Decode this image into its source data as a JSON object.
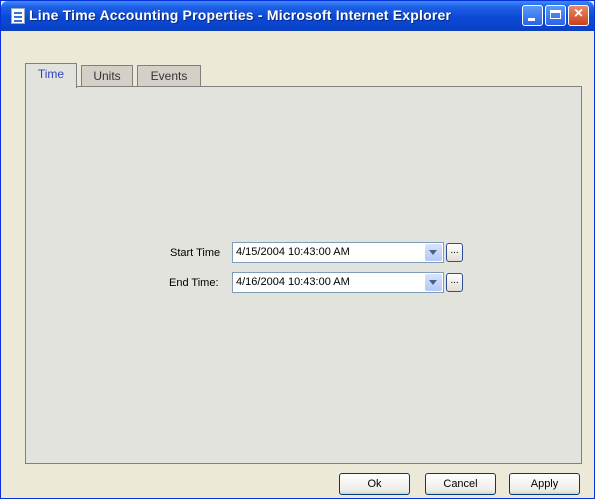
{
  "window": {
    "title": "Line Time Accounting Properties - Microsoft Internet Explorer"
  },
  "tabs": [
    {
      "label": "Time",
      "active": true
    },
    {
      "label": "Units",
      "active": false
    },
    {
      "label": "Events",
      "active": false
    }
  ],
  "form": {
    "start_label": "Start Time",
    "start_value": "4/15/2004 10:43:00 AM",
    "end_label": "End Time:",
    "end_value": "4/16/2004 10:43:00 AM",
    "ellipsis": "..."
  },
  "buttons": {
    "ok": "Ok",
    "cancel": "Cancel",
    "apply": "Apply"
  },
  "colors": {
    "titlebar": "#0a49d6",
    "active_tab_text": "#2b45c8",
    "panel": "#e3e3de"
  }
}
